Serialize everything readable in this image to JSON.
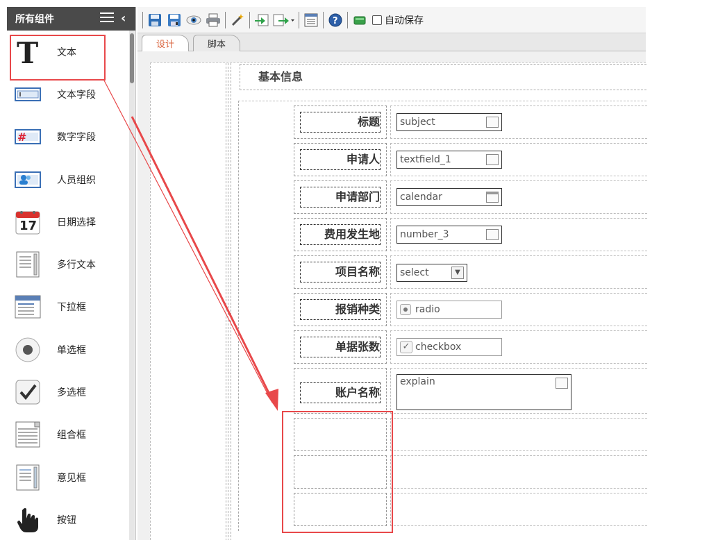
{
  "sidebar": {
    "title": "所有组件",
    "items": [
      {
        "label": "文本",
        "icon": "text-T-icon"
      },
      {
        "label": "文本字段",
        "icon": "textfield-icon"
      },
      {
        "label": "数字字段",
        "icon": "number-field-icon"
      },
      {
        "label": "人员组织",
        "icon": "person-org-icon"
      },
      {
        "label": "日期选择",
        "icon": "calendar-icon"
      },
      {
        "label": "多行文本",
        "icon": "multiline-text-icon"
      },
      {
        "label": "下拉框",
        "icon": "dropdown-icon"
      },
      {
        "label": "单选框",
        "icon": "radio-icon"
      },
      {
        "label": "多选框",
        "icon": "checkbox-icon"
      },
      {
        "label": "组合框",
        "icon": "combobox-icon"
      },
      {
        "label": "意见框",
        "icon": "opinion-box-icon"
      },
      {
        "label": "按钮",
        "icon": "hand-pointer-icon"
      }
    ],
    "calendar_day": "17"
  },
  "toolbar": {
    "autosave_label": "自动保存"
  },
  "tabs": [
    {
      "label": "设计",
      "active": true
    },
    {
      "label": "脚本",
      "active": false
    }
  ],
  "form": {
    "section_title": "基本信息",
    "rows": [
      {
        "label": "标题",
        "value": "subject",
        "type": "textfield"
      },
      {
        "label": "申请人",
        "value": "textfield_1",
        "type": "textfield"
      },
      {
        "label": "申请部门",
        "value": "calendar",
        "type": "calendar"
      },
      {
        "label": "费用发生地",
        "value": "number_3",
        "type": "number"
      },
      {
        "label": "项目名称",
        "value": "select",
        "type": "select"
      },
      {
        "label": "报销种类",
        "value": "radio",
        "type": "radio"
      },
      {
        "label": "单据张数",
        "value": "checkbox",
        "type": "checkbox"
      },
      {
        "label": "账户名称",
        "value": "explain",
        "type": "textarea"
      }
    ]
  },
  "colors": {
    "annotation_red": "#e8484a",
    "active_tab_text": "#d9633c",
    "sidebar_header": "#4a4a4a"
  }
}
